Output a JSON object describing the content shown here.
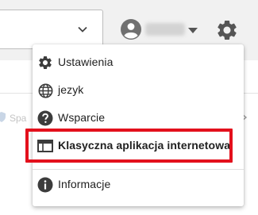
{
  "header": {
    "search_chevron_icon": "chevron-down-icon",
    "avatar_icon": "account-circle-icon",
    "account_caret_icon": "caret-down-icon",
    "settings_icon": "gear-icon"
  },
  "background": {
    "row_label": "Spa",
    "row_icon": "shield-icon"
  },
  "menu": {
    "items": [
      {
        "label": "Ustawienia",
        "icon": "gear-icon"
      },
      {
        "label": "jezyk",
        "icon": "globe-icon"
      },
      {
        "label": "Wsparcie",
        "icon": "help-circle-icon"
      },
      {
        "label": "Klasyczna aplikacja internetowa",
        "icon": "web-window-icon",
        "highlighted": true
      },
      {
        "label": "Informacje",
        "icon": "info-circle-icon"
      }
    ]
  },
  "colors": {
    "highlight_border": "#e3101c",
    "icon": "#3c3c3c",
    "topbar_bg": "#f1f1f1"
  }
}
